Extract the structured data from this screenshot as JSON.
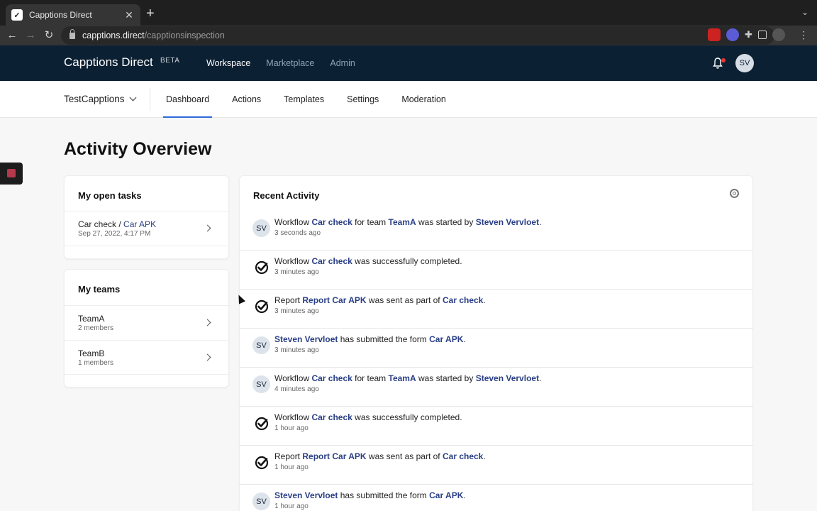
{
  "browser": {
    "tab_title": "Capptions Direct",
    "url_host": "capptions.direct",
    "url_path": "/capptionsinspection"
  },
  "header": {
    "brand": "Capptions Direct",
    "badge": "BETA",
    "nav": [
      "Workspace",
      "Marketplace",
      "Admin"
    ],
    "avatar_initials": "SV"
  },
  "subnav": {
    "team": "TestCapptions",
    "tabs": [
      "Dashboard",
      "Actions",
      "Templates",
      "Settings",
      "Moderation"
    ]
  },
  "page_title": "Activity Overview",
  "open_tasks": {
    "title": "My open tasks",
    "items": [
      {
        "workflow": "Car check",
        "separator": " / ",
        "form": "Car APK",
        "date": "Sep 27, 2022, 4:17 PM"
      }
    ]
  },
  "teams": {
    "title": "My teams",
    "items": [
      {
        "name": "TeamA",
        "members": "2 members"
      },
      {
        "name": "TeamB",
        "members": "1 members"
      }
    ]
  },
  "activity": {
    "title": "Recent Activity",
    "items": [
      {
        "icon": "avatar",
        "initials": "SV",
        "parts": [
          [
            "Workflow ",
            false
          ],
          [
            "Car check",
            true
          ],
          [
            " for team ",
            false
          ],
          [
            "TeamA",
            true
          ],
          [
            " was started by ",
            false
          ],
          [
            "Steven Vervloet",
            true
          ],
          [
            ".",
            false
          ]
        ],
        "time": "3 seconds ago"
      },
      {
        "icon": "check-icon",
        "parts": [
          [
            "Workflow ",
            false
          ],
          [
            "Car check",
            true
          ],
          [
            " was successfully completed.",
            false
          ]
        ],
        "time": "3 minutes ago"
      },
      {
        "icon": "check-icon",
        "parts": [
          [
            "Report ",
            false
          ],
          [
            "Report Car APK",
            true
          ],
          [
            " was sent as part of ",
            false
          ],
          [
            "Car check",
            true
          ],
          [
            ".",
            false
          ]
        ],
        "time": "3 minutes ago"
      },
      {
        "icon": "avatar",
        "initials": "SV",
        "parts": [
          [
            "Steven Vervloet",
            true
          ],
          [
            " has submitted the form ",
            false
          ],
          [
            "Car APK",
            true
          ],
          [
            ".",
            false
          ]
        ],
        "time": "3 minutes ago"
      },
      {
        "icon": "avatar",
        "initials": "SV",
        "parts": [
          [
            "Workflow ",
            false
          ],
          [
            "Car check",
            true
          ],
          [
            " for team ",
            false
          ],
          [
            "TeamA",
            true
          ],
          [
            " was started by ",
            false
          ],
          [
            "Steven Vervloet",
            true
          ],
          [
            ".",
            false
          ]
        ],
        "time": "4 minutes ago"
      },
      {
        "icon": "check-icon",
        "parts": [
          [
            "Workflow ",
            false
          ],
          [
            "Car check",
            true
          ],
          [
            " was successfully completed.",
            false
          ]
        ],
        "time": "1 hour ago"
      },
      {
        "icon": "check-icon",
        "parts": [
          [
            "Report ",
            false
          ],
          [
            "Report Car APK",
            true
          ],
          [
            " was sent as part of ",
            false
          ],
          [
            "Car check",
            true
          ],
          [
            ".",
            false
          ]
        ],
        "time": "1 hour ago"
      },
      {
        "icon": "avatar",
        "initials": "SV",
        "parts": [
          [
            "Steven Vervloet",
            true
          ],
          [
            " has submitted the form ",
            false
          ],
          [
            "Car APK",
            true
          ],
          [
            ".",
            false
          ]
        ],
        "time": "1 hour ago"
      }
    ]
  },
  "colors": {
    "header_bg": "#0c2033",
    "link": "#2a3f86",
    "tab_underline": "#2b6ad8"
  }
}
